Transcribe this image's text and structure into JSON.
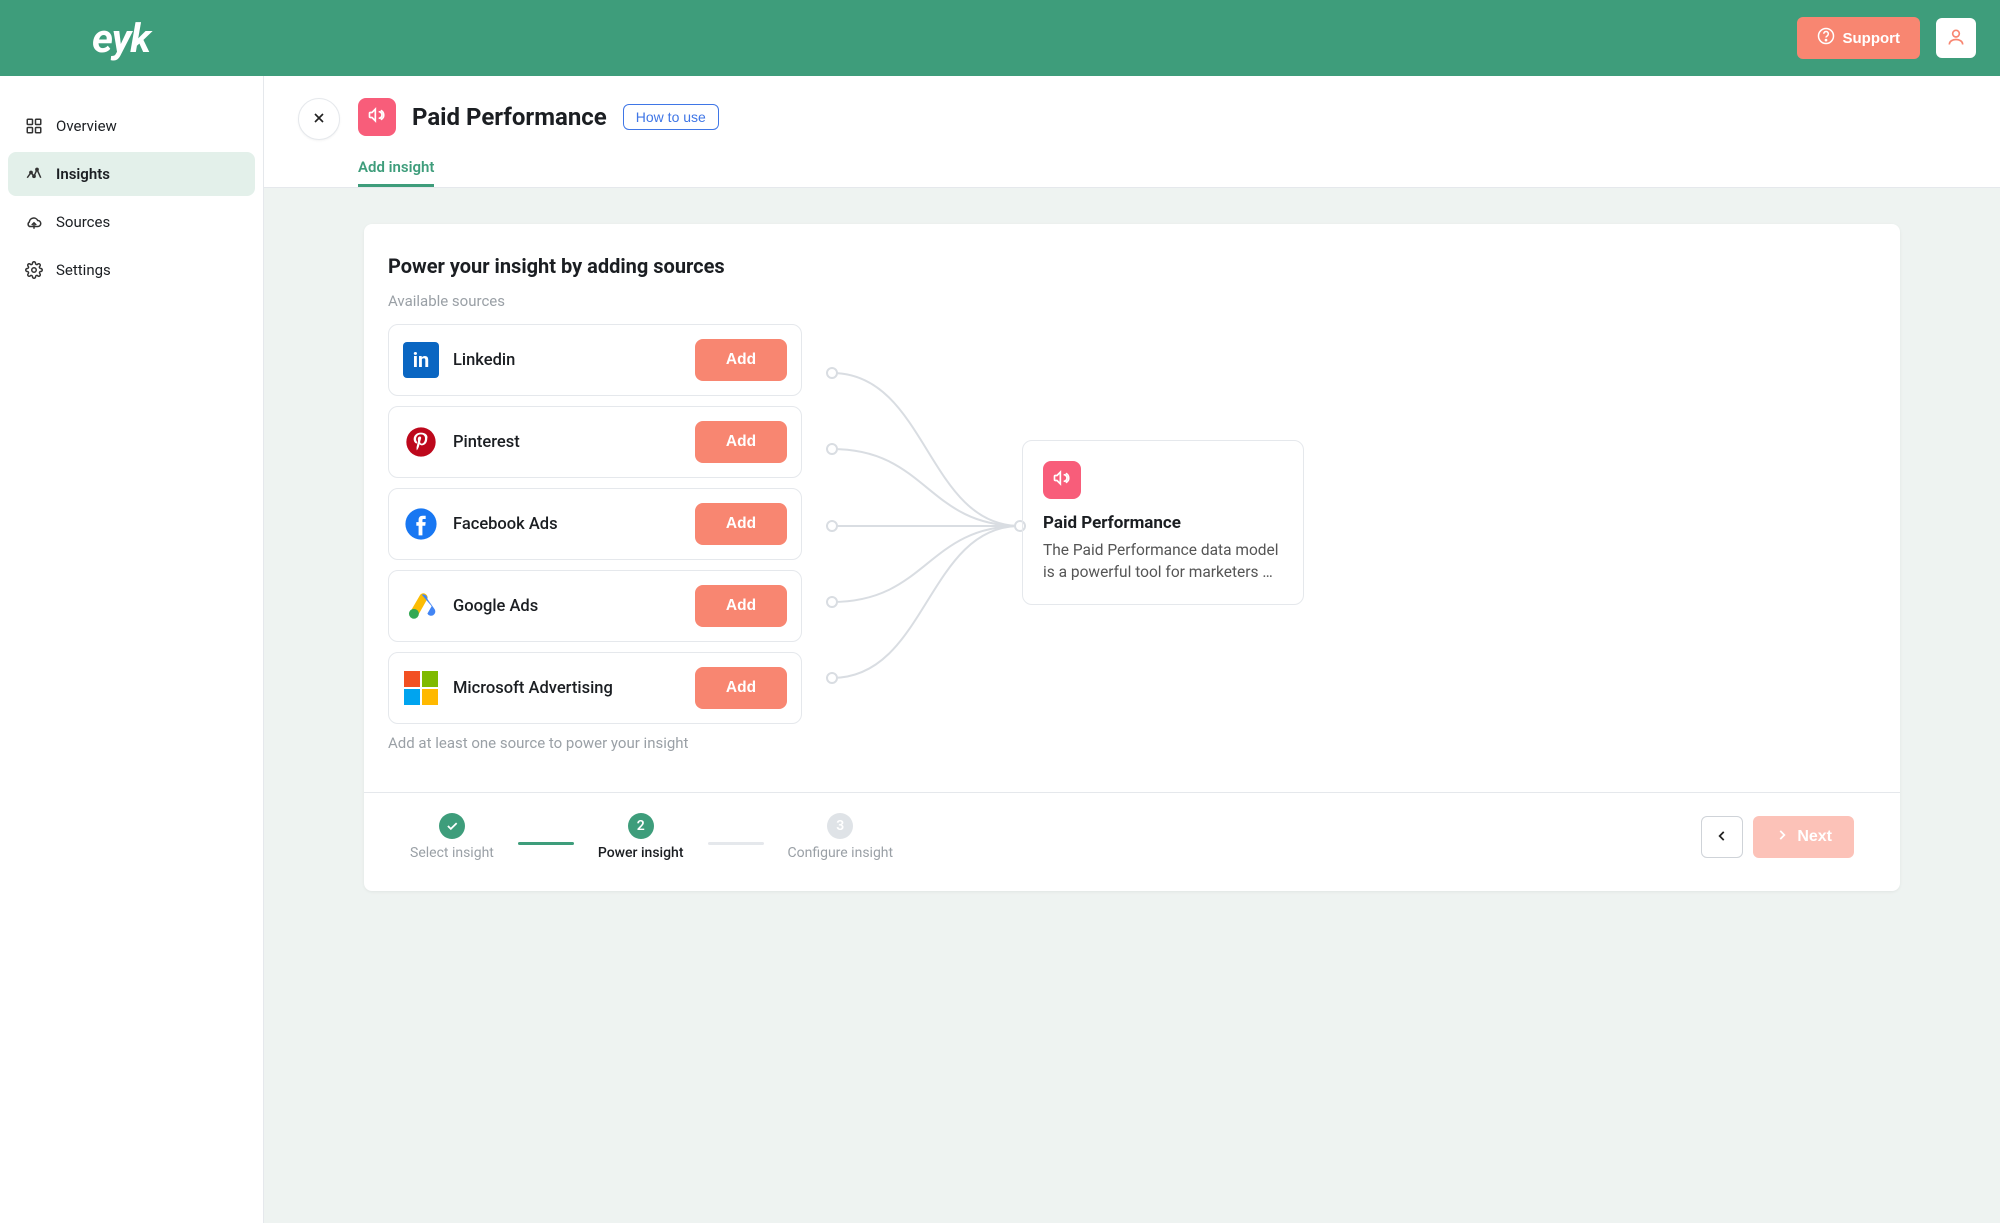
{
  "brand": "eyk",
  "header": {
    "support": "Support"
  },
  "sidebar": {
    "items": [
      {
        "label": "Overview"
      },
      {
        "label": "Insights"
      },
      {
        "label": "Sources"
      },
      {
        "label": "Settings"
      }
    ]
  },
  "page": {
    "title": "Paid Performance",
    "how_to": "How to use",
    "tab_add": "Add insight"
  },
  "card": {
    "title": "Power your insight by adding sources",
    "available": "Available sources",
    "hint": "Add at least one source to power your insight",
    "add_label": "Add",
    "sources": [
      {
        "name": "Linkedin"
      },
      {
        "name": "Pinterest"
      },
      {
        "name": "Facebook Ads"
      },
      {
        "name": "Google Ads"
      },
      {
        "name": "Microsoft Advertising"
      }
    ],
    "destination": {
      "title": "Paid Performance",
      "desc": "The Paid Performance data model is a powerful tool for marketers …"
    }
  },
  "stepper": {
    "steps": [
      {
        "label": "Select insight"
      },
      {
        "label": "Power insight"
      },
      {
        "label": "Configure insight"
      }
    ],
    "step2_num": "2",
    "step3_num": "3",
    "next": "Next"
  }
}
